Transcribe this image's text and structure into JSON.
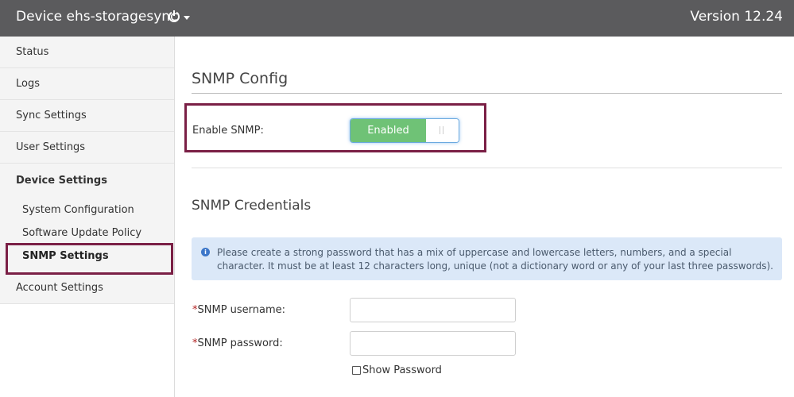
{
  "header": {
    "device_title": "Device ehs-storagesync",
    "version": "Version 12.24",
    "icons": [
      "power-icon",
      "caret-down-icon"
    ]
  },
  "sidebar": {
    "items": [
      {
        "label": "Status"
      },
      {
        "label": "Logs"
      },
      {
        "label": "Sync Settings"
      },
      {
        "label": "User Settings"
      }
    ],
    "group": {
      "title": "Device Settings",
      "items": [
        {
          "label": "System Configuration"
        },
        {
          "label": "Software Update Policy"
        },
        {
          "label": "SNMP Settings",
          "active": true
        }
      ]
    },
    "after_items": [
      {
        "label": "Account Settings"
      }
    ]
  },
  "main": {
    "title": "SNMP Config",
    "enable_snmp": {
      "label": "Enable SNMP:",
      "state": "Enabled"
    },
    "credentials": {
      "title": "SNMP Credentials",
      "info": "Please create a strong password that has a mix of uppercase and lowercase letters, numbers, and a special character. It must be at least 12 characters long, unique (not a dictionary word or any of your last three passwords).",
      "username": {
        "required_mark": "*",
        "label": "SNMP username:",
        "value": ""
      },
      "password": {
        "required_mark": "*",
        "label": "SNMP password:",
        "value": ""
      },
      "show_password": {
        "label": "Show Password",
        "checked": false
      }
    }
  },
  "colors": {
    "topbar": "#5b5b5d",
    "highlight": "#7a1f45",
    "toggle_on": "#6fc276",
    "info_bg": "#dbe8f8"
  }
}
